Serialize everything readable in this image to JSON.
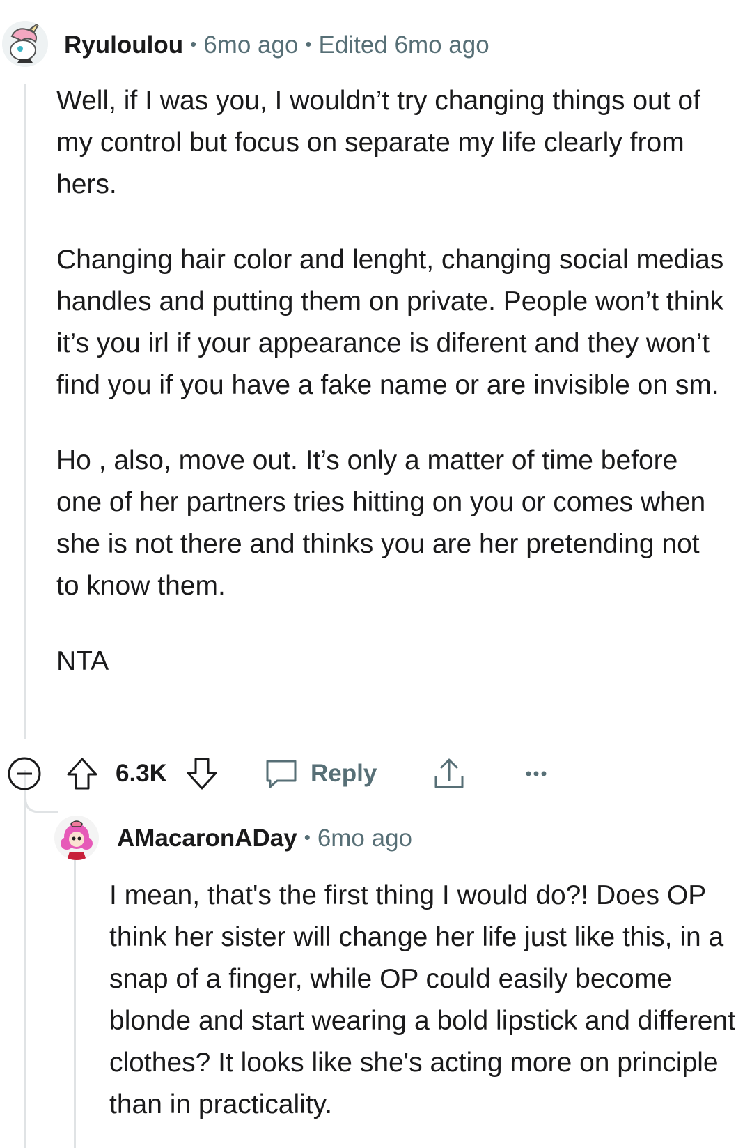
{
  "comments": [
    {
      "author": "Ryuloulou",
      "age": "6mo ago",
      "edited": "Edited 6mo ago",
      "paragraphs": [
        "Well, if I was you, I wouldn’t try changing things out of my control but focus on separate my life clearly from hers.",
        "Changing hair color and lenght, changing social medias handles and putting them on private. People won’t think it’s you irl if your appearance is diferent and they won’t find you if you have a fake name or are invisible on sm.",
        "Ho , also, move out. It’s only a matter of time before one of her partners tries hitting on you or comes when she is not there and thinks you are her pretending not to know them.",
        "NTA"
      ],
      "actions": {
        "score": "6.3K",
        "reply_label": "Reply"
      }
    },
    {
      "author": "AMacaronADay",
      "age": "6mo ago",
      "paragraphs": [
        "I mean, that's the first thing I would do?! Does OP think her sister will change her life just like this, in a snap of a finger, while OP could easily become blonde and start wearing a bold lipstick and different clothes? It looks like she's acting more on principle than in practicality."
      ]
    }
  ],
  "icons": {
    "collapse": "collapse-minus-icon",
    "upvote": "upvote-arrow-icon",
    "downvote": "downvote-arrow-icon",
    "reply": "speech-bubble-icon",
    "share": "share-upload-icon",
    "more": "more-dots-icon"
  },
  "colors": {
    "text": "#1a1a1b",
    "meta": "#576f76",
    "thread_line": "#e0e3e5"
  }
}
